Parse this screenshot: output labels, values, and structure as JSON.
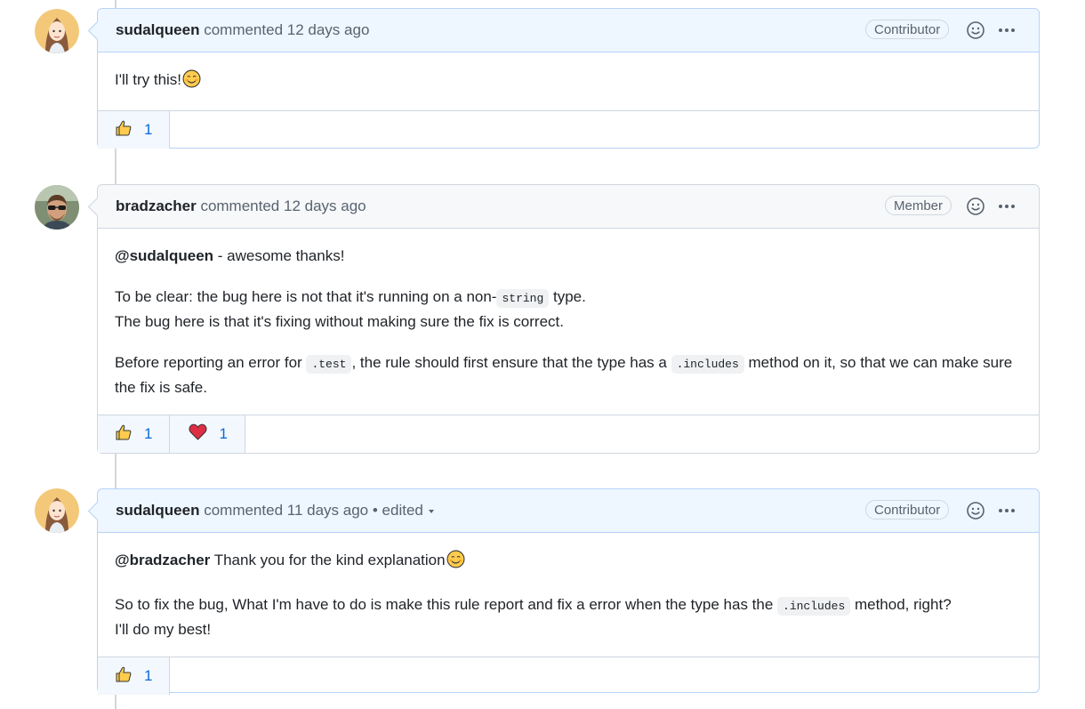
{
  "comments": [
    {
      "author": "sudalqueen",
      "action": "commented",
      "time": "12 days ago",
      "role": "Contributor",
      "body": {
        "text": "I'll try this!"
      },
      "reactions": [
        {
          "emoji": "thumbs-up",
          "count": "1"
        }
      ]
    },
    {
      "author": "bradzacher",
      "action": "commented",
      "time": "12 days ago",
      "role": "Member",
      "body": {
        "p1_mention": "@sudalqueen",
        "p1_text": " - awesome thanks!",
        "p2_a": "To be clear: the bug here is not that it's running on a non-",
        "p2_code": "string",
        "p2_b": " type.",
        "p2_line2": "The bug here is that it's fixing without making sure the fix is correct.",
        "p3_a": "Before reporting an error for ",
        "p3_code1": ".test",
        "p3_b": ", the rule should first ensure that the type has a ",
        "p3_code2": ".includes",
        "p3_c": " method on it, so that we can make sure the fix is safe."
      },
      "reactions": [
        {
          "emoji": "thumbs-up",
          "count": "1"
        },
        {
          "emoji": "heart",
          "count": "1"
        }
      ]
    },
    {
      "author": "sudalqueen",
      "action": "commented",
      "time": "11 days ago",
      "edited": "• edited",
      "role": "Contributor",
      "body": {
        "p1_mention": "@bradzacher",
        "p1_text": " Thank you for the kind explanation",
        "p2_a": "So to fix the bug, What I'm have to do is make this rule report and fix a error when the type has the ",
        "p2_code": ".includes",
        "p2_b": " method, right?",
        "p2_line2": "I'll do my best!"
      },
      "reactions": [
        {
          "emoji": "thumbs-up",
          "count": "1"
        }
      ]
    }
  ],
  "icons": {
    "smiley": "smiley-icon",
    "more": "kebab-horizontal-icon",
    "blush": "blush-emoji",
    "thumbs": "thumbs-up-emoji",
    "heart": "heart-emoji"
  },
  "colors": {
    "link": "#0969da",
    "border": "#d0d7de",
    "highlight_header": "#eef6ff"
  }
}
